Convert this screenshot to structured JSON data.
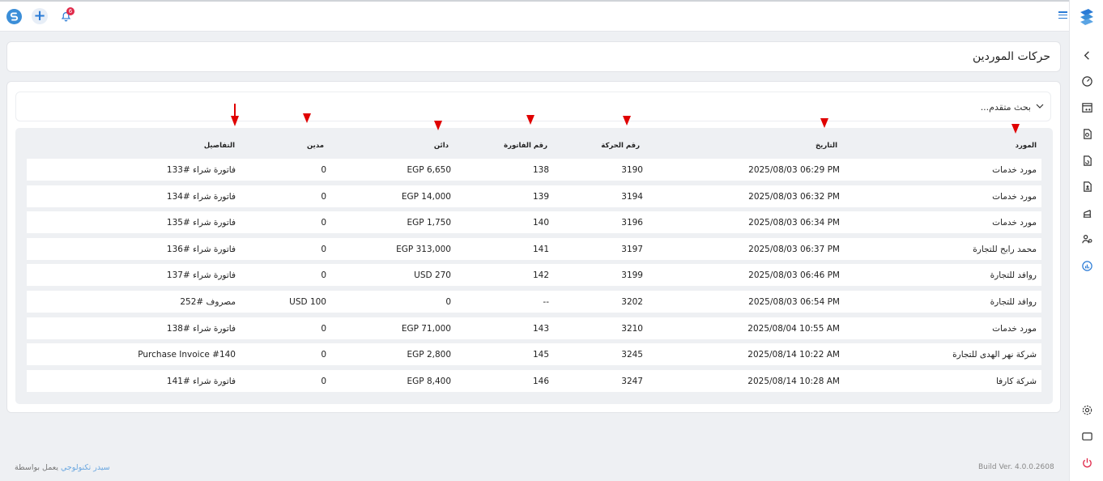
{
  "topbar": {
    "notification_count": "6"
  },
  "page": {
    "title": "حركات الموردين"
  },
  "search": {
    "label": "بحث متقدم..."
  },
  "table": {
    "headers": {
      "supplier": "المورد",
      "date": "التاريخ",
      "movement_no": "رقم الحركة",
      "invoice_no": "رقم الفاتورة",
      "credit": "دائن",
      "debit": "مدين",
      "details": "التفاصيل"
    },
    "rows": [
      {
        "supplier": "مورد خدمات",
        "date": "2025/08/03 06:29 PM",
        "movement_no": "3190",
        "invoice_no": "138",
        "credit": "EGP 6,650",
        "debit": "0",
        "details": "فاتورة شراء #133"
      },
      {
        "supplier": "مورد خدمات",
        "date": "2025/08/03 06:32 PM",
        "movement_no": "3194",
        "invoice_no": "139",
        "credit": "EGP 14,000",
        "debit": "0",
        "details": "فاتورة شراء #134"
      },
      {
        "supplier": "مورد خدمات",
        "date": "2025/08/03 06:34 PM",
        "movement_no": "3196",
        "invoice_no": "140",
        "credit": "EGP 1,750",
        "debit": "0",
        "details": "فاتورة شراء #135"
      },
      {
        "supplier": "محمد رابح للتجارة",
        "date": "2025/08/03 06:37 PM",
        "movement_no": "3197",
        "invoice_no": "141",
        "credit": "EGP 313,000",
        "debit": "0",
        "details": "فاتورة شراء #136"
      },
      {
        "supplier": "روافد للتجارة",
        "date": "2025/08/03 06:46 PM",
        "movement_no": "3199",
        "invoice_no": "142",
        "credit": "USD 270",
        "debit": "0",
        "details": "فاتورة شراء #137"
      },
      {
        "supplier": "روافد للتجارة",
        "date": "2025/08/03 06:54 PM",
        "movement_no": "3202",
        "invoice_no": "--",
        "credit": "0",
        "debit": "USD 100",
        "details": "مصروف #252"
      },
      {
        "supplier": "مورد خدمات",
        "date": "2025/08/04 10:55 AM",
        "movement_no": "3210",
        "invoice_no": "143",
        "credit": "EGP 71,000",
        "debit": "0",
        "details": "فاتورة شراء #138"
      },
      {
        "supplier": "شركة  نهر الهدى للتجارة",
        "date": "2025/08/14 10:22 AM",
        "movement_no": "3245",
        "invoice_no": "145",
        "credit": "EGP 2,800",
        "debit": "0",
        "details": "Purchase Invoice #140"
      },
      {
        "supplier": "شركة كارفا",
        "date": "2025/08/14 10:28 AM",
        "movement_no": "3247",
        "invoice_no": "146",
        "credit": "EGP 8,400",
        "debit": "0",
        "details": "فاتورة شراء #141"
      }
    ]
  },
  "footer": {
    "powered_prefix": "يعمل بواسطة",
    "powered_brand": "سيدر تكنولوجي",
    "build": "Build Ver. 4.0.0.2608"
  },
  "colors": {
    "accent": "#2a7bd6",
    "arrow": "#e00000",
    "badge": "#e0294a",
    "power": "#e0294a"
  },
  "sidebar_icons": [
    "chevron-left-icon",
    "speedometer-icon",
    "window-cart-icon",
    "document-search-icon",
    "document-refresh-icon",
    "document-user-icon",
    "warehouse-icon",
    "users-settings-icon",
    "chart-document-icon"
  ],
  "sidebar_bottom_icons": [
    "settings-icon",
    "tablet-icon",
    "power-icon"
  ]
}
